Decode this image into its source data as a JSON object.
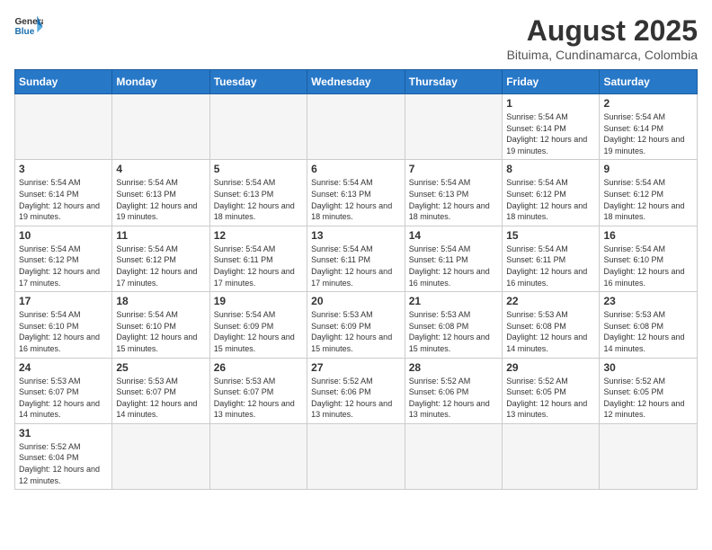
{
  "header": {
    "logo_general": "General",
    "logo_blue": "Blue",
    "month_year": "August 2025",
    "location": "Bituima, Cundinamarca, Colombia"
  },
  "weekdays": [
    "Sunday",
    "Monday",
    "Tuesday",
    "Wednesday",
    "Thursday",
    "Friday",
    "Saturday"
  ],
  "weeks": [
    [
      {
        "day": "",
        "info": ""
      },
      {
        "day": "",
        "info": ""
      },
      {
        "day": "",
        "info": ""
      },
      {
        "day": "",
        "info": ""
      },
      {
        "day": "",
        "info": ""
      },
      {
        "day": "1",
        "info": "Sunrise: 5:54 AM\nSunset: 6:14 PM\nDaylight: 12 hours and 19 minutes."
      },
      {
        "day": "2",
        "info": "Sunrise: 5:54 AM\nSunset: 6:14 PM\nDaylight: 12 hours and 19 minutes."
      }
    ],
    [
      {
        "day": "3",
        "info": "Sunrise: 5:54 AM\nSunset: 6:14 PM\nDaylight: 12 hours and 19 minutes."
      },
      {
        "day": "4",
        "info": "Sunrise: 5:54 AM\nSunset: 6:13 PM\nDaylight: 12 hours and 19 minutes."
      },
      {
        "day": "5",
        "info": "Sunrise: 5:54 AM\nSunset: 6:13 PM\nDaylight: 12 hours and 18 minutes."
      },
      {
        "day": "6",
        "info": "Sunrise: 5:54 AM\nSunset: 6:13 PM\nDaylight: 12 hours and 18 minutes."
      },
      {
        "day": "7",
        "info": "Sunrise: 5:54 AM\nSunset: 6:13 PM\nDaylight: 12 hours and 18 minutes."
      },
      {
        "day": "8",
        "info": "Sunrise: 5:54 AM\nSunset: 6:12 PM\nDaylight: 12 hours and 18 minutes."
      },
      {
        "day": "9",
        "info": "Sunrise: 5:54 AM\nSunset: 6:12 PM\nDaylight: 12 hours and 18 minutes."
      }
    ],
    [
      {
        "day": "10",
        "info": "Sunrise: 5:54 AM\nSunset: 6:12 PM\nDaylight: 12 hours and 17 minutes."
      },
      {
        "day": "11",
        "info": "Sunrise: 5:54 AM\nSunset: 6:12 PM\nDaylight: 12 hours and 17 minutes."
      },
      {
        "day": "12",
        "info": "Sunrise: 5:54 AM\nSunset: 6:11 PM\nDaylight: 12 hours and 17 minutes."
      },
      {
        "day": "13",
        "info": "Sunrise: 5:54 AM\nSunset: 6:11 PM\nDaylight: 12 hours and 17 minutes."
      },
      {
        "day": "14",
        "info": "Sunrise: 5:54 AM\nSunset: 6:11 PM\nDaylight: 12 hours and 16 minutes."
      },
      {
        "day": "15",
        "info": "Sunrise: 5:54 AM\nSunset: 6:11 PM\nDaylight: 12 hours and 16 minutes."
      },
      {
        "day": "16",
        "info": "Sunrise: 5:54 AM\nSunset: 6:10 PM\nDaylight: 12 hours and 16 minutes."
      }
    ],
    [
      {
        "day": "17",
        "info": "Sunrise: 5:54 AM\nSunset: 6:10 PM\nDaylight: 12 hours and 16 minutes."
      },
      {
        "day": "18",
        "info": "Sunrise: 5:54 AM\nSunset: 6:10 PM\nDaylight: 12 hours and 15 minutes."
      },
      {
        "day": "19",
        "info": "Sunrise: 5:54 AM\nSunset: 6:09 PM\nDaylight: 12 hours and 15 minutes."
      },
      {
        "day": "20",
        "info": "Sunrise: 5:53 AM\nSunset: 6:09 PM\nDaylight: 12 hours and 15 minutes."
      },
      {
        "day": "21",
        "info": "Sunrise: 5:53 AM\nSunset: 6:08 PM\nDaylight: 12 hours and 15 minutes."
      },
      {
        "day": "22",
        "info": "Sunrise: 5:53 AM\nSunset: 6:08 PM\nDaylight: 12 hours and 14 minutes."
      },
      {
        "day": "23",
        "info": "Sunrise: 5:53 AM\nSunset: 6:08 PM\nDaylight: 12 hours and 14 minutes."
      }
    ],
    [
      {
        "day": "24",
        "info": "Sunrise: 5:53 AM\nSunset: 6:07 PM\nDaylight: 12 hours and 14 minutes."
      },
      {
        "day": "25",
        "info": "Sunrise: 5:53 AM\nSunset: 6:07 PM\nDaylight: 12 hours and 14 minutes."
      },
      {
        "day": "26",
        "info": "Sunrise: 5:53 AM\nSunset: 6:07 PM\nDaylight: 12 hours and 13 minutes."
      },
      {
        "day": "27",
        "info": "Sunrise: 5:52 AM\nSunset: 6:06 PM\nDaylight: 12 hours and 13 minutes."
      },
      {
        "day": "28",
        "info": "Sunrise: 5:52 AM\nSunset: 6:06 PM\nDaylight: 12 hours and 13 minutes."
      },
      {
        "day": "29",
        "info": "Sunrise: 5:52 AM\nSunset: 6:05 PM\nDaylight: 12 hours and 13 minutes."
      },
      {
        "day": "30",
        "info": "Sunrise: 5:52 AM\nSunset: 6:05 PM\nDaylight: 12 hours and 12 minutes."
      }
    ],
    [
      {
        "day": "31",
        "info": "Sunrise: 5:52 AM\nSunset: 6:04 PM\nDaylight: 12 hours and 12 minutes."
      },
      {
        "day": "",
        "info": ""
      },
      {
        "day": "",
        "info": ""
      },
      {
        "day": "",
        "info": ""
      },
      {
        "day": "",
        "info": ""
      },
      {
        "day": "",
        "info": ""
      },
      {
        "day": "",
        "info": ""
      }
    ]
  ]
}
